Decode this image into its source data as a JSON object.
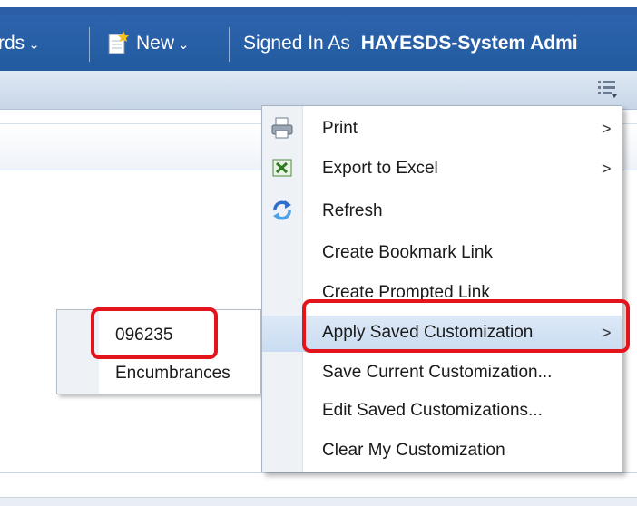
{
  "topbar": {
    "dashboards_partial": "rds",
    "new_label": "New",
    "signed_in_prefix": "Signed In As",
    "signed_in_user": "HAYESDS-System Admi"
  },
  "submenu": {
    "items": [
      "096235",
      "Encumbrances"
    ]
  },
  "menu": {
    "items": [
      {
        "label": "Print",
        "icon": "printer-icon",
        "submenu": true
      },
      {
        "label": "Export to Excel",
        "icon": "excel-icon",
        "submenu": true
      },
      {
        "label": "Refresh",
        "icon": "refresh-icon",
        "submenu": false
      },
      {
        "label": "Create Bookmark Link",
        "icon": "",
        "submenu": false
      },
      {
        "label": "Create Prompted Link",
        "icon": "",
        "submenu": false
      },
      {
        "label": "Apply Saved Customization",
        "icon": "",
        "submenu": true
      },
      {
        "label": "Save Current Customization...",
        "icon": "",
        "submenu": false
      },
      {
        "label": "Edit Saved Customizations...",
        "icon": "",
        "submenu": false
      },
      {
        "label": "Clear My Customization",
        "icon": "",
        "submenu": false
      }
    ],
    "arrow_glyph": ">"
  },
  "colors": {
    "header_blue": "#215a9e",
    "highlight": "#c9dcf1",
    "callout_red": "#e3141b"
  }
}
